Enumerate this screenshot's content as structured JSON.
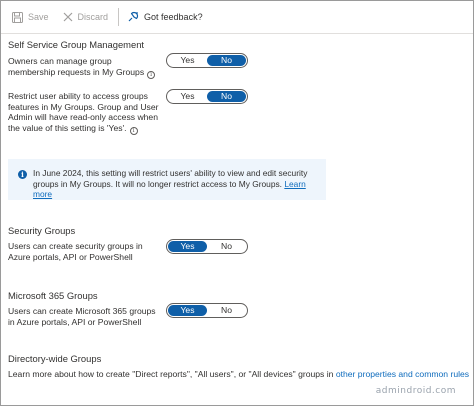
{
  "toolbar": {
    "save_label": "Save",
    "discard_label": "Discard",
    "feedback_label": "Got feedback?"
  },
  "self_service": {
    "title": "Self Service Group Management",
    "owners_label": "Owners can manage group membership requests in My Groups",
    "owners_yes": "Yes",
    "owners_no": "No",
    "owners_selected": "No",
    "restrict_label": "Restrict user ability to access groups features in My Groups. Group and User Admin will have read-only access when the value of this setting is 'Yes'.",
    "restrict_yes": "Yes",
    "restrict_no": "No",
    "restrict_selected": "No"
  },
  "info_banner": {
    "text": "In June 2024, this setting will restrict users' ability to view and edit security groups in My Groups. It will no longer restrict access to My Groups.",
    "link": "Learn more"
  },
  "security_groups": {
    "title": "Security Groups",
    "label": "Users can create security groups in Azure portals, API or PowerShell",
    "yes": "Yes",
    "no": "No",
    "selected": "Yes"
  },
  "m365_groups": {
    "title": "Microsoft 365 Groups",
    "label": "Users can create Microsoft 365 groups in Azure portals, API or PowerShell",
    "yes": "Yes",
    "no": "No",
    "selected": "Yes"
  },
  "directory_wide": {
    "title": "Directory-wide Groups",
    "text": "Learn more about how to create \"Direct reports\", \"All users\", or \"All devices\" groups in",
    "link": "other properties and common rules"
  },
  "watermark": "admindroid.com",
  "colors": {
    "accent": "#0f5fa8",
    "link": "#0f6cbd",
    "info_bg": "#eef5fc"
  }
}
